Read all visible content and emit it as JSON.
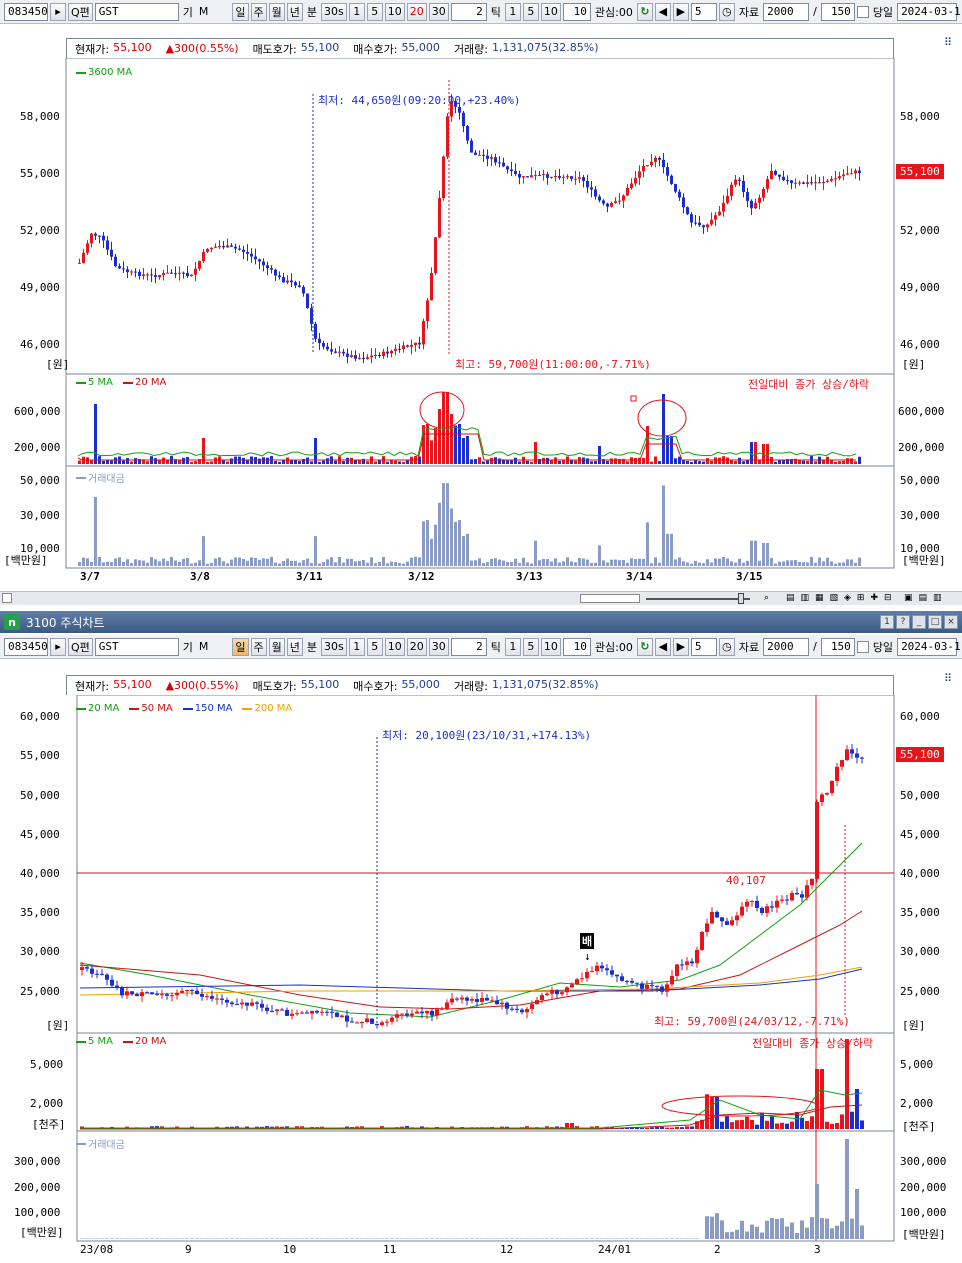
{
  "top_toolbar": {
    "code": "083450",
    "name": "GST",
    "gi_label": "기",
    "m_label": "M",
    "period_buttons": [
      "일",
      "주",
      "월",
      "년"
    ],
    "minute_label": "분",
    "sec_label": "30s",
    "minute_values": [
      "1",
      "5",
      "10",
      "20",
      "30"
    ],
    "tick_value": "2",
    "tick_label": "틱",
    "tick_values": [
      "1",
      "5",
      "10"
    ],
    "tick_input": "10",
    "interest_label": "관심:00",
    "step_value": "5",
    "data_label": "자료",
    "data_count": "2000",
    "slash": "/",
    "view_count": "150",
    "today_label": "당일",
    "date": "2024-03-1",
    "search_btn_label": "Q편"
  },
  "top_chart": {
    "info": {
      "current_price_label": "현재가:",
      "current_price": "55,100",
      "change": "▲300(0.55%)",
      "ask_label": "매도호가:",
      "ask": "55,100",
      "bid_label": "매수호가:",
      "bid": "55,000",
      "volume_label": "거래량:",
      "volume": "1,131,075(32.85%)"
    },
    "legend_ma": "3600 MA",
    "price_tag": "55,100",
    "unit": "[원]",
    "annot_low": "최저: 44,650원(09:20:00,+23.40%)",
    "annot_high": "최고: 59,700원(11:00:00,-7.71%)",
    "y_ticks": [
      "58,000",
      "55,000",
      "52,000",
      "49,000",
      "46,000"
    ],
    "vol_legend_5": "5 MA",
    "vol_legend_20": "20 MA",
    "vol_note": "전일대비 종가 상승/하락",
    "vol_ticks": [
      "600,000",
      "200,000"
    ],
    "amount_legend": "거래대금",
    "amount_ticks": [
      "50,000",
      "30,000",
      "10,000"
    ],
    "amount_unit": "[백만원]",
    "x_labels": [
      "3/7",
      "3/8",
      "3/11",
      "3/12",
      "3/13",
      "3/14",
      "3/15"
    ]
  },
  "bottom_window": {
    "title": "3100 주식차트",
    "title_icon": "n",
    "win_buttons": [
      "1",
      "?",
      "_",
      "□",
      "×"
    ]
  },
  "bottom_toolbar": {
    "code": "083450",
    "name": "GST",
    "gi_label": "기",
    "m_label": "M",
    "period_buttons": [
      "일",
      "주",
      "월",
      "년"
    ],
    "minute_label": "분",
    "sec_label": "30s",
    "minute_values": [
      "1",
      "5",
      "10",
      "20",
      "30"
    ],
    "tick_value": "2",
    "tick_label": "틱",
    "tick_values": [
      "1",
      "5",
      "10"
    ],
    "tick_input": "10",
    "interest_label": "관심:00",
    "step_value": "5",
    "data_label": "자료",
    "data_count": "2000",
    "slash": "/",
    "view_count": "150",
    "today_label": "당일",
    "date": "2024-03-1",
    "search_btn_label": "Q편"
  },
  "bottom_chart": {
    "info": {
      "current_price_label": "현재가:",
      "current_price": "55,100",
      "change": "▲300(0.55%)",
      "ask_label": "매도호가:",
      "ask": "55,100",
      "bid_label": "매수호가:",
      "bid": "55,000",
      "volume_label": "거래량:",
      "volume": "1,131,075(32.85%)"
    },
    "legend": [
      {
        "label": "20 MA",
        "color": "#12a012"
      },
      {
        "label": "50 MA",
        "color": "#c81414"
      },
      {
        "label": "150 MA",
        "color": "#1432c8"
      },
      {
        "label": "200 MA",
        "color": "#f0a000"
      }
    ],
    "price_tag": "55,100",
    "unit": "[원]",
    "annot_low": "최저: 20,100원(23/10/31,+174.13%)",
    "annot_high": "최고: 59,700원(24/03/12,-7.71%)",
    "annot_line": "40,107",
    "marker_label": "배",
    "y_ticks": [
      "60,000",
      "55,000",
      "50,000",
      "45,000",
      "40,000",
      "35,000",
      "30,000",
      "25,000"
    ],
    "vol_legend_5": "5 MA",
    "vol_legend_20": "20 MA",
    "vol_note": "전일대비 종가 상승/하락",
    "vol_ticks": [
      "5,000",
      "2,000"
    ],
    "vol_unit": "[천주]",
    "amount_legend": "거래대금",
    "amount_ticks": [
      "300,000",
      "200,000",
      "100,000"
    ],
    "amount_unit": "[백만원]",
    "x_labels": [
      "23/08",
      "9",
      "10",
      "11",
      "12",
      "24/01",
      "2",
      "3"
    ]
  },
  "colors": {
    "up": "#e8141b",
    "down": "#1a2ed0",
    "amount": "#8a9bc4",
    "ma5": "#12a012",
    "ma20": "#c81414"
  }
}
